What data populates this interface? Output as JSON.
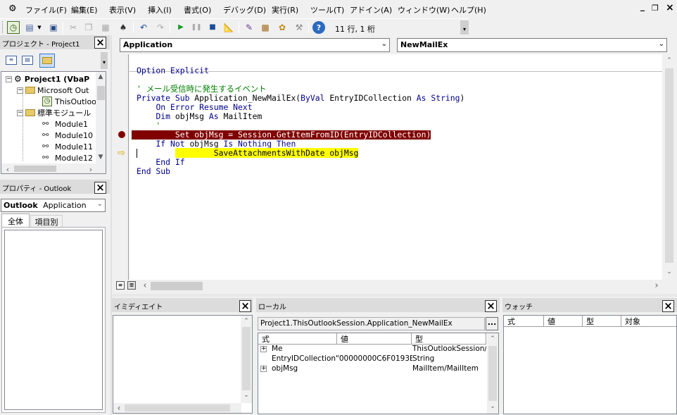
{
  "menu": {
    "items": [
      "ファイル(F)",
      "編集(E)",
      "表示(V)",
      "挿入(I)",
      "書式(O)",
      "デバッグ(D)",
      "実行(R)",
      "ツール(T)",
      "アドイン(A)",
      "ウィンドウ(W)",
      "ヘルプ(H)"
    ],
    "minimize": "_",
    "restore": "❐",
    "close": "×"
  },
  "toolbar": {
    "cursor_position": "11 行, 1 桁"
  },
  "project": {
    "title": "プロジェクト - Project1",
    "root": "Project1 (VbaP",
    "folder1": "Microsoft Out",
    "item1": "ThisOutloo",
    "folder2": "標準モジュール",
    "modules": [
      "Module1",
      "Module10",
      "Module11",
      "Module12"
    ]
  },
  "properties": {
    "title": "プロパティ - Outlook",
    "object_name": "Outlook",
    "object_type": "Application",
    "tab_all": "全体",
    "tab_category": "項目別"
  },
  "editor": {
    "object_combo": "Application",
    "proc_combo": "NewMailEx",
    "code_lines": [
      "Option Explicit",
      "",
      "' メール受信時に発生するイベント",
      "Private Sub Application_NewMailEx(ByVal EntryIDCollection As String)",
      "    On Error Resume Next",
      "    Dim objMsg As MailItem",
      "    '",
      "    Set objMsg = Session.GetItemFromID(EntryIDCollection)",
      "    If Not objMsg Is Nothing Then",
      "        SaveAttachmentsWithDate objMsg",
      "    End If",
      "End Sub"
    ]
  },
  "immediate": {
    "title": "イミディエイト"
  },
  "locals": {
    "title": "ローカル",
    "context": "Project1.ThisOutlookSession.Application_NewMailEx",
    "context_button": "...",
    "columns": [
      "式",
      "値",
      "型"
    ],
    "rows": [
      {
        "expr": "Me",
        "value": "",
        "type": "ThisOutlookSession/",
        "expandable": true
      },
      {
        "expr": "EntryIDCollection",
        "value": "\"00000000C6F0193E",
        "type": "String",
        "expandable": false
      },
      {
        "expr": "objMsg",
        "value": "",
        "type": "MailItem/MailItem",
        "expandable": true
      }
    ]
  },
  "watch": {
    "title": "ウォッチ",
    "columns": [
      "式",
      "値",
      "型",
      "対象"
    ]
  },
  "colors": {
    "breakpoint": "#800000",
    "current_line": "#ffff00",
    "keyword": "#00008b",
    "comment": "#008000"
  }
}
